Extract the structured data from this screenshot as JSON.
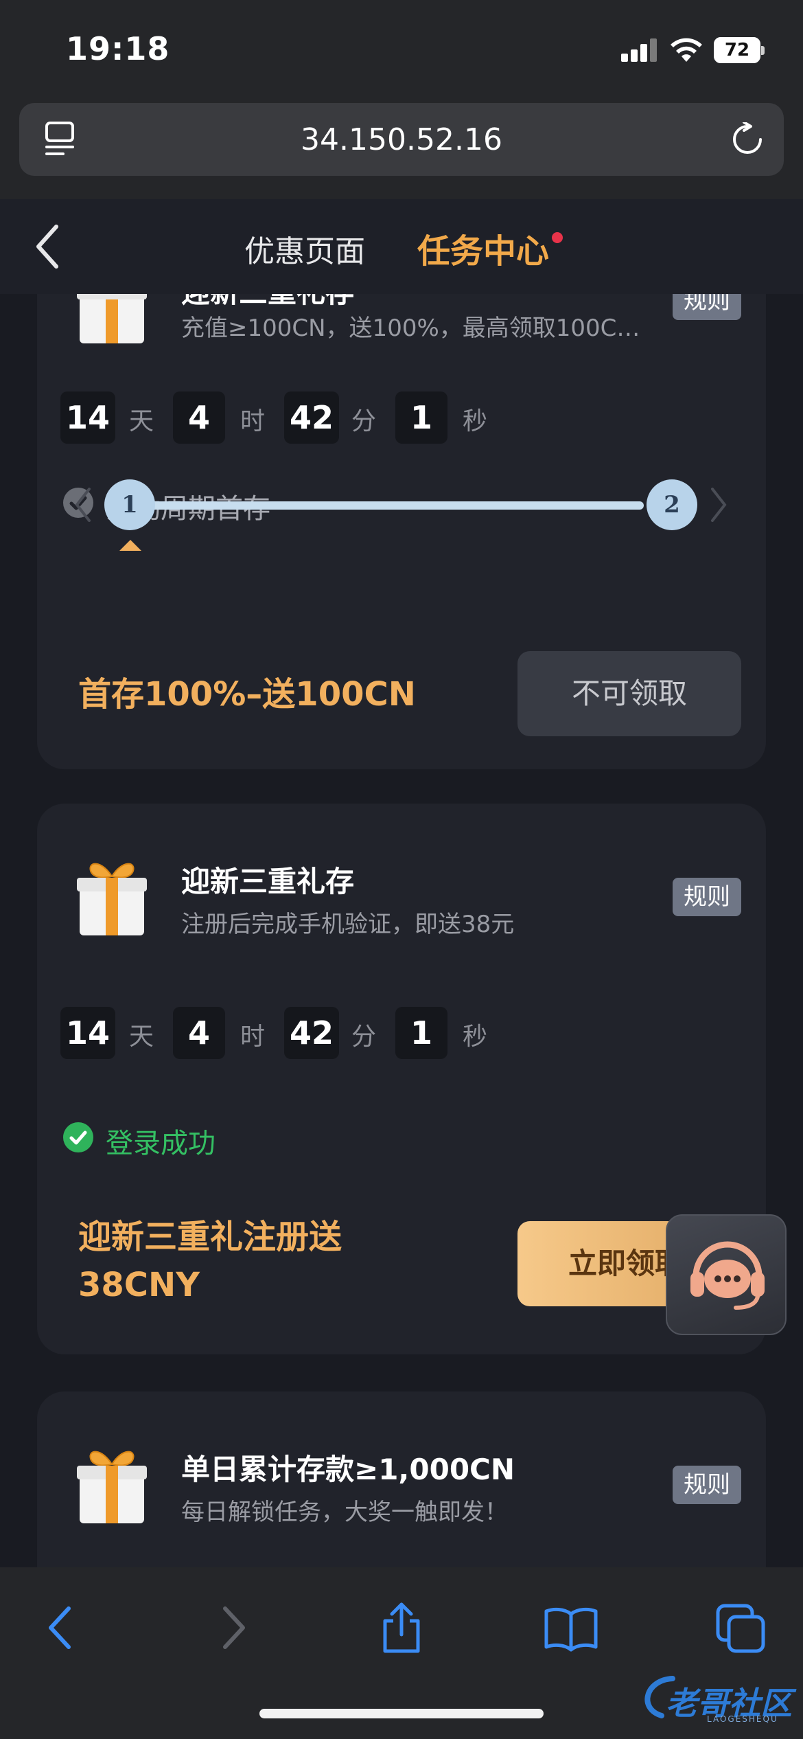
{
  "status": {
    "time": "19:18",
    "battery": "72"
  },
  "browser": {
    "url": "34.150.52.16"
  },
  "nav": {
    "tab_promo": "优惠页面",
    "tab_tasks": "任务中心"
  },
  "cards": [
    {
      "title": "迎新三重礼存",
      "subtitle": "充值≥100CN，送100%，最高领取100C…",
      "rule": "规则",
      "countdown": {
        "days": "14",
        "days_unit": "天",
        "hours": "4",
        "hours_unit": "时",
        "minutes": "42",
        "minutes_unit": "分",
        "seconds": "1",
        "seconds_unit": "秒"
      },
      "condition": "活动周期首存",
      "steps": [
        "1",
        "2"
      ],
      "reward": "首存100%–送100CN",
      "button": "不可领取"
    },
    {
      "title": "迎新三重礼存",
      "subtitle": "注册后完成手机验证，即送38元",
      "rule": "规则",
      "countdown": {
        "days": "14",
        "days_unit": "天",
        "hours": "4",
        "hours_unit": "时",
        "minutes": "42",
        "minutes_unit": "分",
        "seconds": "1",
        "seconds_unit": "秒"
      },
      "condition": "登录成功",
      "reward_line1": "迎新三重礼注册送",
      "reward_line2": "38CNY",
      "button": "立即领取"
    },
    {
      "title": "单日累计存款≥1,000CN",
      "subtitle": "每日解锁任务，大奖一触即发！",
      "rule": "规则"
    }
  ],
  "watermark": {
    "text": "老哥社区",
    "sub": "LAOGESHEQU"
  },
  "colors": {
    "accent": "#f2a94a",
    "success": "#2fb35b",
    "link_blue": "#3b8cf5"
  }
}
